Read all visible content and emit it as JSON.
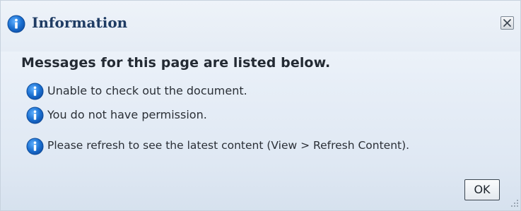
{
  "dialog": {
    "title": "Information",
    "heading": "Messages for this page are listed below.",
    "messages": [
      {
        "icon": "info-icon",
        "text": "Unable to check out the document."
      },
      {
        "icon": "info-icon",
        "text": "You do not have permission."
      },
      {
        "icon": "info-icon",
        "text": "Please refresh to see the latest content (View > Refresh Content)."
      }
    ],
    "ok_label": "OK",
    "close_icon": "close-icon",
    "title_icon": "info-icon",
    "resize_icon": "resize-grip-icon"
  },
  "colors": {
    "title_text": "#1f3c64",
    "info_icon_fill": "#1a6fd0",
    "background": "#e7eef7"
  }
}
